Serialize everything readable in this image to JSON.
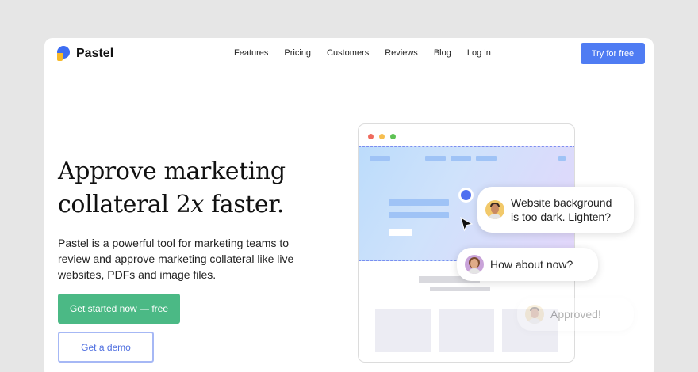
{
  "brand": {
    "name": "Pastel",
    "colors": {
      "accent": "#4f7cf3",
      "primary_button": "#4bb985",
      "logo_blue": "#3d6df2",
      "logo_yellow": "#f7b928"
    }
  },
  "nav": {
    "items": [
      {
        "label": "Features"
      },
      {
        "label": "Pricing"
      },
      {
        "label": "Customers"
      },
      {
        "label": "Reviews"
      },
      {
        "label": "Blog"
      },
      {
        "label": "Log in"
      }
    ],
    "cta_label": "Try for free"
  },
  "hero": {
    "headline_line1": "Approve marketing",
    "headline_line2_a": "collateral 2",
    "headline_line2_italic": "x",
    "headline_line2_b": " faster.",
    "description": "Pastel is a powerful tool for marketing teams to review and approve marketing collateral like live websites, PDFs and image files.",
    "primary_button": "Get started now — free",
    "secondary_button": "Get a demo"
  },
  "illustration": {
    "comments": [
      {
        "text_line1": "Website background",
        "text_line2": "is too dark. Lighten?"
      },
      {
        "text": "How about now?"
      },
      {
        "text": "Approved!"
      }
    ]
  }
}
